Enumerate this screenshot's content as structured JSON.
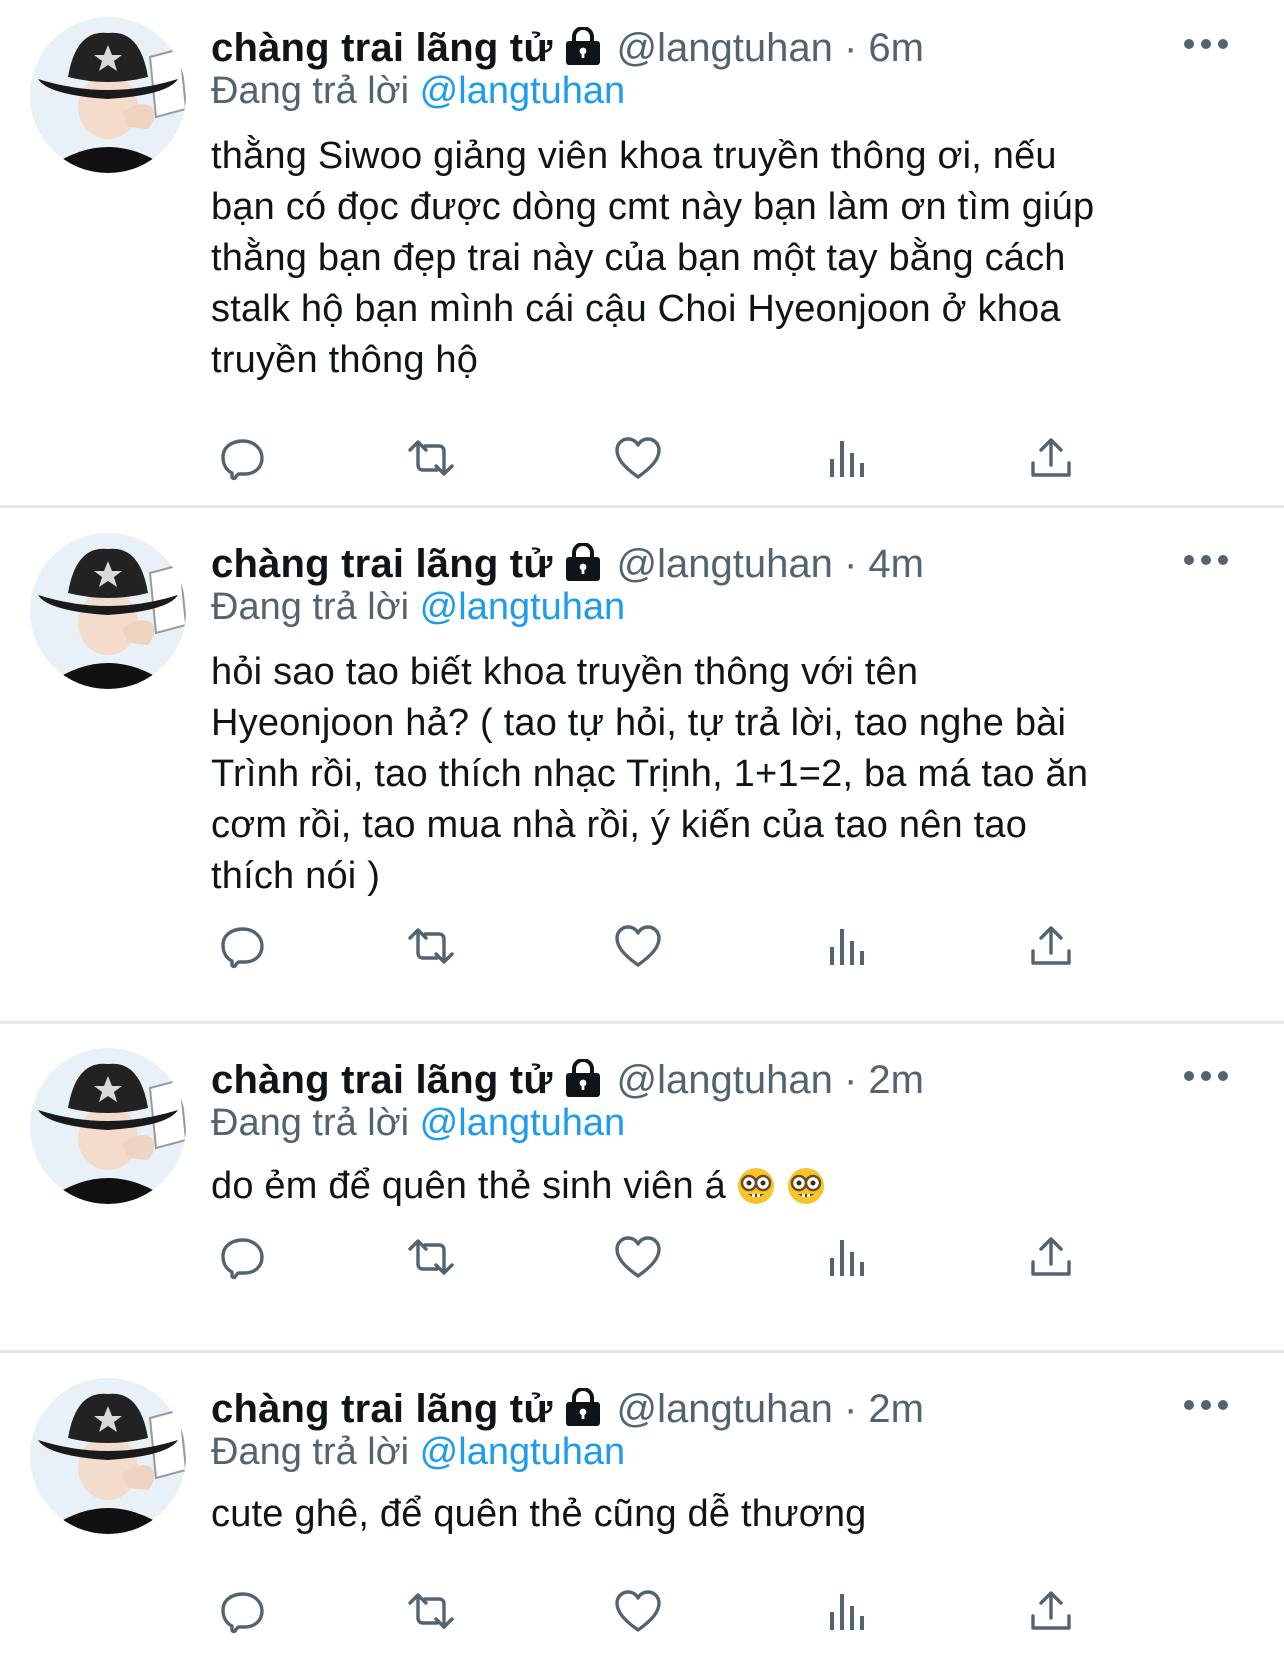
{
  "colors": {
    "text_primary": "#0f1419",
    "text_secondary": "#536471",
    "mention": "#1d9bf0",
    "divider": "#e3e6ea"
  },
  "tweets": [
    {
      "display_name": "chàng trai lãng tử",
      "handle_time": "@langtuhan · 6m",
      "replying_prefix": "Đang trả lời",
      "replying_handle": "@langtuhan",
      "lines": [
        "thằng Siwoo giảng viên khoa truyền thông ơi, nếu",
        "bạn có đọc được dòng cmt này bạn làm ơn tìm giúp",
        "thằng bạn đẹp trai này của bạn một tay bằng cách",
        "stalk hộ bạn mình cái cậu Choi Hyeonjoon ở khoa",
        "truyền thông hộ"
      ]
    },
    {
      "display_name": "chàng trai lãng tử",
      "handle_time": "@langtuhan · 4m",
      "replying_prefix": "Đang trả lời",
      "replying_handle": "@langtuhan",
      "lines": [
        "hỏi sao tao biết khoa truyền thông với tên",
        "Hyeonjoon hả? ( tao tự hỏi, tự trả lời, tao nghe bài",
        "Trình rồi, tao thích nhạc Trịnh, 1+1=2, ba má tao ăn",
        "cơm rồi, tao mua nhà rồi, ý kiến của tao nên tao",
        "thích nói )"
      ]
    },
    {
      "display_name": "chàng trai lãng tử",
      "handle_time": "@langtuhan · 2m",
      "replying_prefix": "Đang trả lời",
      "replying_handle": "@langtuhan",
      "lines": [
        "do ẻm để quên thẻ sinh viên á"
      ],
      "emoji": [
        "nerd-face-emoji",
        "nerd-face-emoji"
      ]
    },
    {
      "display_name": "chàng trai lãng tử",
      "handle_time": "@langtuhan · 2m",
      "replying_prefix": "Đang trả lời",
      "replying_handle": "@langtuhan",
      "lines": [
        "cute ghê, để quên thẻ cũng dễ thương"
      ]
    }
  ],
  "icons": {
    "lock": "lock-icon",
    "more": "more-options-icon",
    "reply": "reply-icon",
    "retweet": "retweet-icon",
    "like": "heart-icon",
    "analytics": "analytics-icon",
    "share": "share-icon"
  }
}
